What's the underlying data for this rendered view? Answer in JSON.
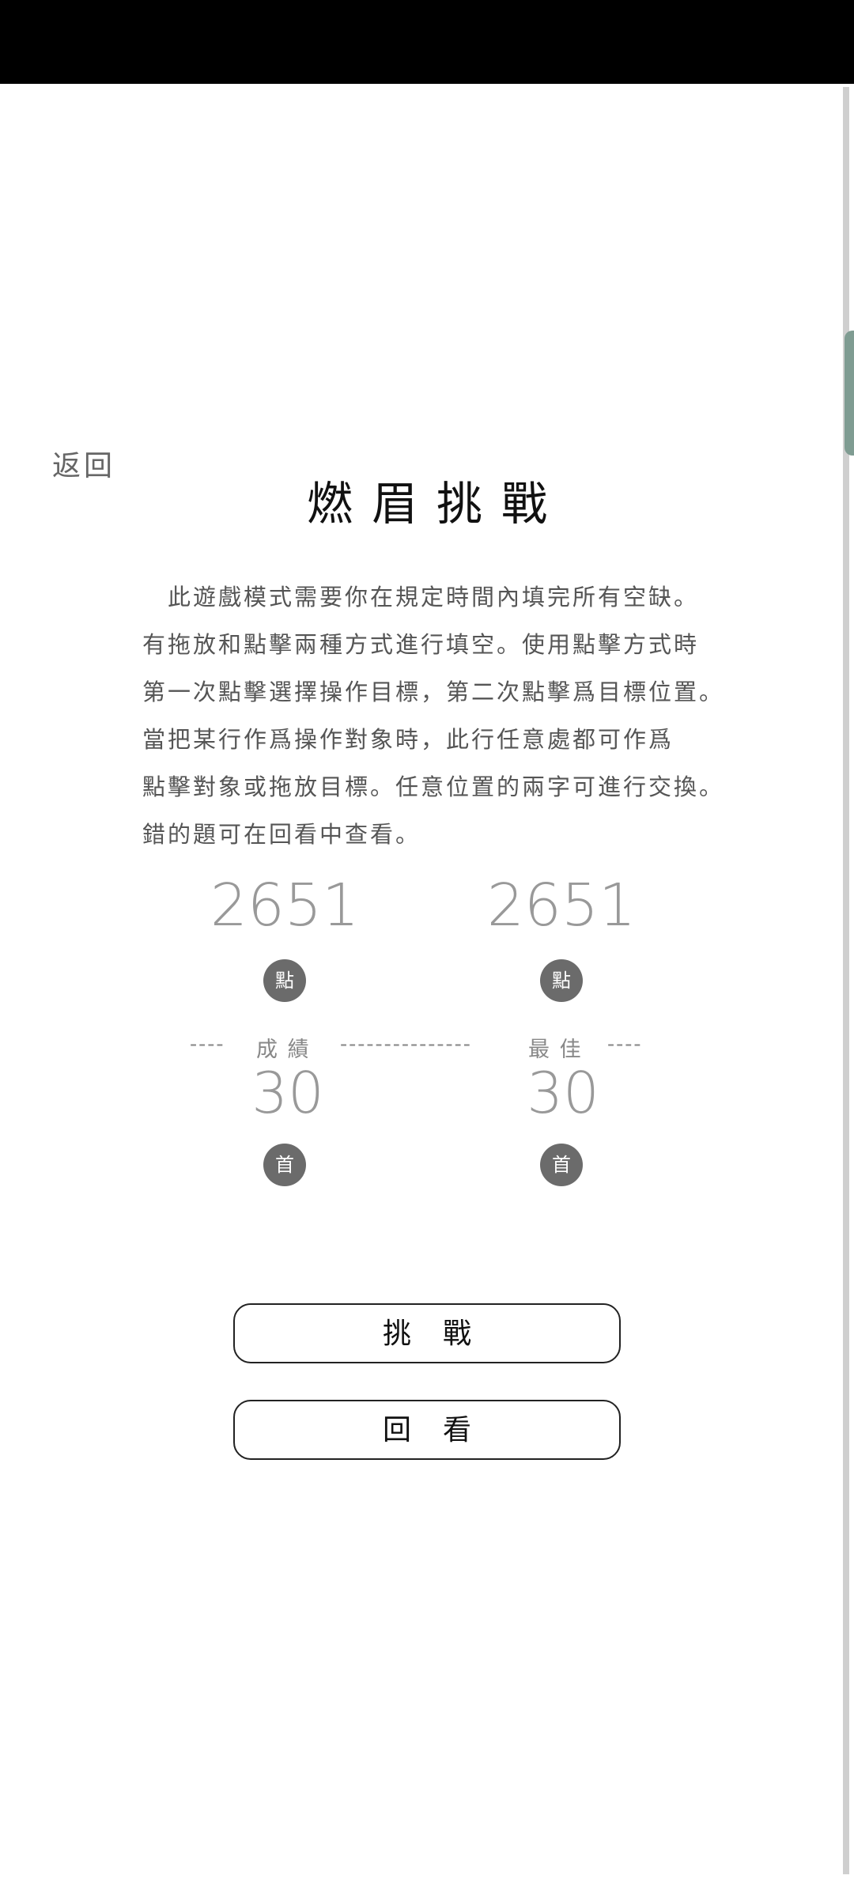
{
  "nav": {
    "back_label": "返回"
  },
  "title": "燃眉挑戰",
  "intro_lines": [
    "　此遊戲模式需要你在規定時間內填完所有空缺。",
    "有拖放和點擊兩種方式進行填空。使用點擊方式時",
    "第一次點擊選擇操作目標，第二次點擊爲目標位置。",
    "當把某行作爲操作對象時，此行任意處都可作爲",
    "點擊對象或拖放目標。任意位置的兩字可進行交換。",
    "錯的題可在回看中查看。"
  ],
  "stats": {
    "current": {
      "label": "成 績",
      "score": "2651",
      "score_unit": "點",
      "count": "30",
      "count_unit": "首"
    },
    "best": {
      "label": "最 佳",
      "score": "2651",
      "score_unit": "點",
      "count": "30",
      "count_unit": "首"
    }
  },
  "divider": {
    "left": "----",
    "middle": "---------------",
    "right": "----"
  },
  "actions": {
    "challenge_label": "挑戰",
    "review_label": "回看"
  },
  "colors": {
    "status_bar": "#000000",
    "scroll_thumb": "#7f9c92",
    "badge": "#6b6b6b"
  }
}
